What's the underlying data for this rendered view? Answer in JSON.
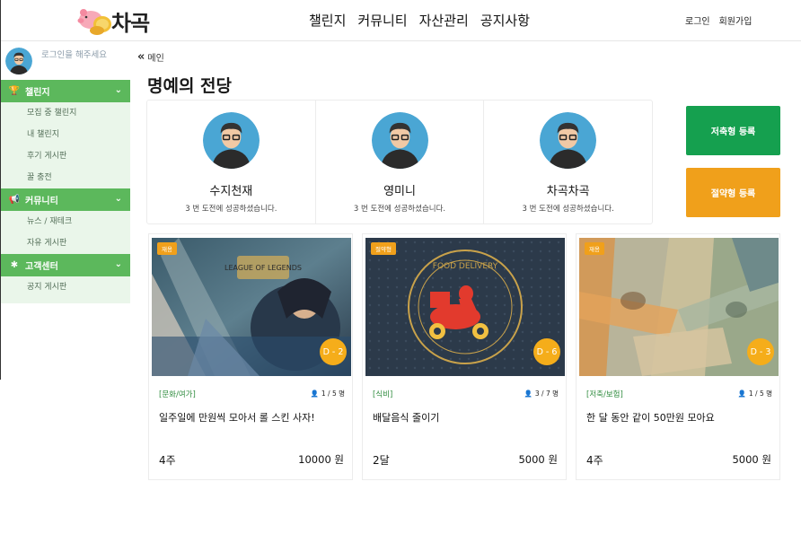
{
  "header": {
    "logo_text": "차곡",
    "nav": [
      "챌린지",
      "커뮤니티",
      "자산관리",
      "공지사항"
    ],
    "login": "로그인",
    "signup": "회원가입"
  },
  "sidebar": {
    "login_prompt": "로그인을 해주세요",
    "sections": [
      {
        "title": "챌린지",
        "icon": "trophy-icon",
        "items": [
          "모집 중 챌린지",
          "내 챌린지",
          "후기 게시판",
          "꿀 충전"
        ]
      },
      {
        "title": "커뮤니티",
        "icon": "megaphone-icon",
        "items": [
          "뉴스 / 재테크",
          "자유 게시판"
        ]
      },
      {
        "title": "고객센터",
        "icon": "asterisk-icon",
        "items": [
          "공지 게시판"
        ]
      }
    ]
  },
  "breadcrumb": "메인",
  "page_title": "명예의 전당",
  "hall_of_fame": [
    {
      "name": "수지천재",
      "desc": "3 번 도전에 성공하셨습니다."
    },
    {
      "name": "영미니",
      "desc": "3 번 도전에 성공하셨습니다."
    },
    {
      "name": "차곡차곡",
      "desc": "3 번 도전에 성공하셨습니다."
    }
  ],
  "buttons": {
    "savings_register": "저축형 등록",
    "frugal_register": "절약형 등록"
  },
  "challenges": [
    {
      "badge": "재용",
      "dday": "D - 2",
      "category": "[문화/여가]",
      "people": "1 / 5 명",
      "title": "일주일에 만원씩 모아서 롤 스킨 사자!",
      "period": "4주",
      "price": "10000 원",
      "thumb_text": "LEAGUE OF LEGENDS"
    },
    {
      "badge": "절약형",
      "dday": "D - 6",
      "category": "[식비]",
      "people": "3 / 7 명",
      "title": "배달음식 줄이기",
      "period": "2달",
      "price": "5000 원",
      "thumb_text": "FOOD DELIVERY"
    },
    {
      "badge": "재용",
      "dday": "D - 3",
      "category": "[저축/보험]",
      "people": "1 / 5 명",
      "title": "한 달 동안 같이 50만원 모아요",
      "period": "4주",
      "price": "5000 원",
      "thumb_text": ""
    }
  ],
  "colors": {
    "sidebar_green": "#5cb85c",
    "sidebar_sub_bg": "#eaf6ea",
    "button_green": "#15a04f",
    "button_orange": "#f0a01b",
    "dday_yellow": "#f5ad1a",
    "category_green": "#2e8b3d"
  }
}
